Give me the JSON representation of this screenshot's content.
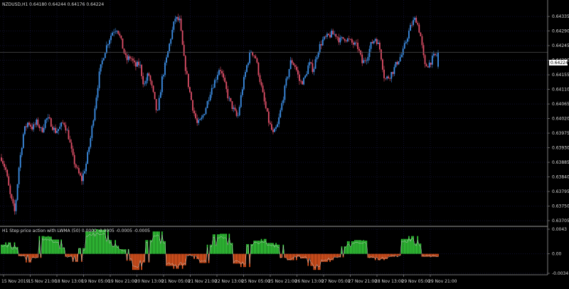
{
  "main_chart": {
    "symbol_header": "NZDUSD,H1  0.64180 0.64244 0.64176 0.64224",
    "current_price_tag": "0.64224",
    "price_ticks": [
      "0.64335",
      "0.64290",
      "0.64245",
      "0.64200",
      "0.64155",
      "0.64110",
      "0.64065",
      "0.64020",
      "0.63975",
      "0.63930",
      "0.63885",
      "0.63840",
      "0.63795",
      "0.63750",
      "0.63705"
    ],
    "colors": {
      "bull": "#3d8fe6",
      "bear": "#e05068",
      "grid": "#1f1f5a",
      "background": "#000000",
      "axis_text": "#d8d8d8"
    }
  },
  "indicator": {
    "title": "H1 Step price action with LWMA (50) 0.0000 -0.0005 -0.0005 -0.0005",
    "value_ticks": [
      "0.0043",
      "0.00",
      "-0.0034"
    ],
    "colors": {
      "positive": "#36d63c",
      "negative": "#f05a20",
      "signal": "#c8c8c8"
    }
  },
  "time_axis": {
    "labels": [
      "15 Nov 2019",
      "15 Nov 21:00",
      "18 Nov 13:00",
      "19 Nov 05:00",
      "19 Nov 21:00",
      "20 Nov 13:00",
      "21 Nov 05:00",
      "21 Nov 21:00",
      "22 Nov 13:00",
      "25 Nov 05:00",
      "25 Nov 21:00",
      "26 Nov 13:00",
      "27 Nov 05:00",
      "27 Nov 21:00",
      "28 Nov 13:00",
      "29 Nov 05:00",
      "29 Nov 21:00"
    ]
  },
  "chart_data": [
    {
      "type": "candlestick",
      "title": "NZDUSD,H1",
      "ohlc_last": {
        "open": 0.6418,
        "high": 0.64244,
        "low": 0.64176,
        "close": 0.64224
      },
      "x_labels": [
        "15 Nov 2019",
        "15 Nov 21:00",
        "18 Nov 13:00",
        "19 Nov 05:00",
        "19 Nov 21:00",
        "20 Nov 13:00",
        "21 Nov 05:00",
        "21 Nov 21:00",
        "22 Nov 13:00",
        "25 Nov 05:00",
        "25 Nov 21:00",
        "26 Nov 13:00",
        "27 Nov 05:00",
        "27 Nov 21:00",
        "28 Nov 13:00",
        "29 Nov 05:00",
        "29 Nov 21:00"
      ],
      "ylim": [
        0.63705,
        0.64355
      ],
      "y_ticks": [
        0.64335,
        0.6429,
        0.64245,
        0.642,
        0.64155,
        0.6411,
        0.64065,
        0.6402,
        0.63975,
        0.6393,
        0.63885,
        0.6384,
        0.63795,
        0.6375,
        0.63705
      ],
      "close_path": [
        0.639,
        0.6386,
        0.6378,
        0.6373,
        0.6388,
        0.6398,
        0.6401,
        0.6399,
        0.6401,
        0.6398,
        0.6402,
        0.6401,
        0.6398,
        0.6399,
        0.6401,
        0.6397,
        0.639,
        0.6386,
        0.6383,
        0.6388,
        0.6396,
        0.6406,
        0.6416,
        0.6422,
        0.6426,
        0.6429,
        0.643,
        0.6425,
        0.642,
        0.6421,
        0.6418,
        0.6419,
        0.6412,
        0.6416,
        0.641,
        0.6403,
        0.6414,
        0.642,
        0.6427,
        0.6433,
        0.6432,
        0.642,
        0.6412,
        0.6405,
        0.64,
        0.6402,
        0.6406,
        0.6411,
        0.6414,
        0.6418,
        0.6413,
        0.6408,
        0.6405,
        0.6402,
        0.6411,
        0.6418,
        0.6423,
        0.6421,
        0.6414,
        0.6407,
        0.6401,
        0.6397,
        0.64,
        0.6407,
        0.6414,
        0.642,
        0.6418,
        0.6413,
        0.6414,
        0.6419,
        0.6417,
        0.6423,
        0.6426,
        0.6427,
        0.6428,
        0.6428,
        0.6426,
        0.6427,
        0.6426,
        0.6425,
        0.6424,
        0.6419,
        0.6421,
        0.6425,
        0.6427,
        0.6423,
        0.6414,
        0.6415,
        0.6417,
        0.642,
        0.6422,
        0.6427,
        0.6431,
        0.6433,
        0.6428,
        0.6418,
        0.6419,
        0.6421,
        0.6422
      ],
      "current_price": 0.64224
    },
    {
      "type": "histogram",
      "title": "H1 Step price action with LWMA (50)",
      "ylim": [
        -0.0034,
        0.0043
      ],
      "y_ticks": [
        0.0043,
        0.0,
        -0.0034
      ],
      "values": [
        0.0016,
        0.002,
        0.0012,
        -0.0004,
        -0.0015,
        -0.0007,
        0.0031,
        0.003,
        0.0025,
        0.0011,
        -0.0005,
        -0.0014,
        0.001,
        0.0039,
        0.0043,
        0.0042,
        0.0024,
        0.0014,
        0.0008,
        -0.0012,
        -0.0028,
        -0.0015,
        0.0024,
        0.0039,
        0.0022,
        -0.0021,
        -0.0026,
        -0.002,
        -0.0003,
        -0.0009,
        -0.0016,
        0.0016,
        0.0034,
        0.0035,
        0.0019,
        -0.0017,
        -0.0023,
        0.0017,
        0.0023,
        0.0026,
        0.0019,
        0.0016,
        -0.0007,
        -0.0011,
        -0.0005,
        -0.0008,
        -0.0021,
        -0.0028,
        -0.0014,
        -0.0011,
        -0.0006,
        0.0013,
        0.0022,
        0.0024,
        0.0023,
        -0.0007,
        -0.0011,
        -0.0009,
        -0.0005,
        -0.0003,
        0.0026,
        0.0031,
        0.0018,
        -0.0005,
        -0.0005,
        -0.0005
      ]
    }
  ]
}
